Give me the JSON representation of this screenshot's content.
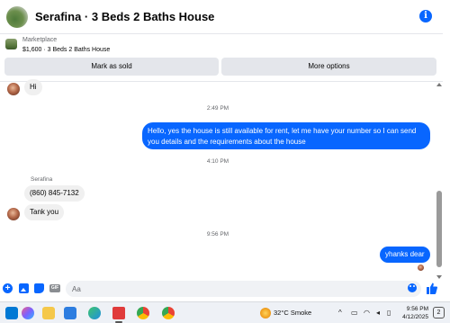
{
  "header": {
    "title": "Serafina · 3 Beds 2 Baths House",
    "info_icon": "info-icon"
  },
  "marketplace": {
    "label": "Marketplace",
    "listing": "$1,600 · 3 Beds 2 Baths House",
    "mark_sold_label": "Mark as sold",
    "more_options_label": "More options"
  },
  "messages": {
    "m1": "Hi",
    "t1": "2:49 PM",
    "m2": "Hello, yes the house is still available for rent, let me have your number so I can send you details and the requirements about the house",
    "t2": "4:10 PM",
    "sender": "Serafina",
    "m3": "(860) 845-7132",
    "m4": "Tank you",
    "t3": "9:56 PM",
    "m5": "yhanks dear"
  },
  "composer": {
    "placeholder": "Aa",
    "gif_label": "GIF"
  },
  "taskbar": {
    "weather": "32°C  Smoke",
    "time": "9:56 PM",
    "date": "4/12/2025",
    "notification_count": "2",
    "tray_chevron": "^"
  },
  "colors": {
    "accent": "#0866ff",
    "bubble_in": "#f0f0f0",
    "taskbar": "#eef1f6"
  }
}
